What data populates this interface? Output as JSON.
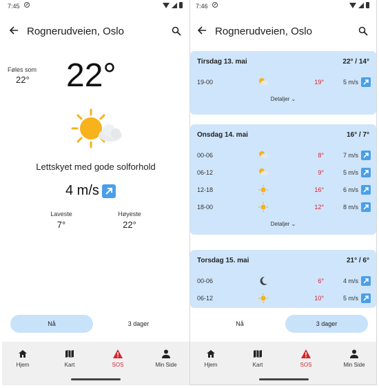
{
  "left": {
    "status": {
      "time": "7:45"
    },
    "appbar": {
      "title": "Rognerudveien, Oslo"
    },
    "feels": {
      "label": "Føles som",
      "value": "22°"
    },
    "temperature": "22°",
    "weather_icon": "partly-sunny-icon",
    "description": "Lettskyet med gode solforhold",
    "wind": "4 m/s",
    "min": {
      "label": "Laveste",
      "value": "7°"
    },
    "max": {
      "label": "Høyeste",
      "value": "22°"
    },
    "segment": {
      "now": "Nå",
      "three_days": "3 dager",
      "active": "now"
    }
  },
  "right": {
    "status": {
      "time": "7:46"
    },
    "appbar": {
      "title": "Rognerudveien, Oslo"
    },
    "days": [
      {
        "title": "Tirsdag 13. mai",
        "range": "22° / 14°",
        "details": "Detaljer",
        "rows": [
          {
            "period": "19-00",
            "icon": "partly-cloudy-icon",
            "temp": "19°",
            "wind": "5 m/s"
          }
        ]
      },
      {
        "title": "Onsdag 14. mai",
        "range": "16° / 7°",
        "details": "Detaljer",
        "rows": [
          {
            "period": "00-06",
            "icon": "partly-cloudy-icon",
            "temp": "8°",
            "wind": "7 m/s"
          },
          {
            "period": "06-12",
            "icon": "partly-cloudy-icon",
            "temp": "9°",
            "wind": "5 m/s"
          },
          {
            "period": "12-18",
            "icon": "sun-icon",
            "temp": "16°",
            "wind": "6 m/s"
          },
          {
            "period": "18-00",
            "icon": "sun-icon",
            "temp": "12°",
            "wind": "8 m/s"
          }
        ]
      },
      {
        "title": "Torsdag 15. mai",
        "range": "21° / 6°",
        "rows": [
          {
            "period": "00-06",
            "icon": "moon-icon",
            "temp": "6°",
            "wind": "4 m/s"
          },
          {
            "period": "06-12",
            "icon": "sun-icon",
            "temp": "10°",
            "wind": "5 m/s"
          }
        ]
      }
    ],
    "segment": {
      "now": "Nå",
      "three_days": "3 dager",
      "active": "three_days"
    }
  },
  "nav": {
    "home": "Hjem",
    "map": "Kart",
    "sos": "SOS",
    "profile": "Min Side"
  },
  "colors": {
    "accent": "#c8e2fa",
    "card": "#cfe5fb",
    "sos": "#d8232a",
    "wind_arrow": "#4a9fe8"
  }
}
